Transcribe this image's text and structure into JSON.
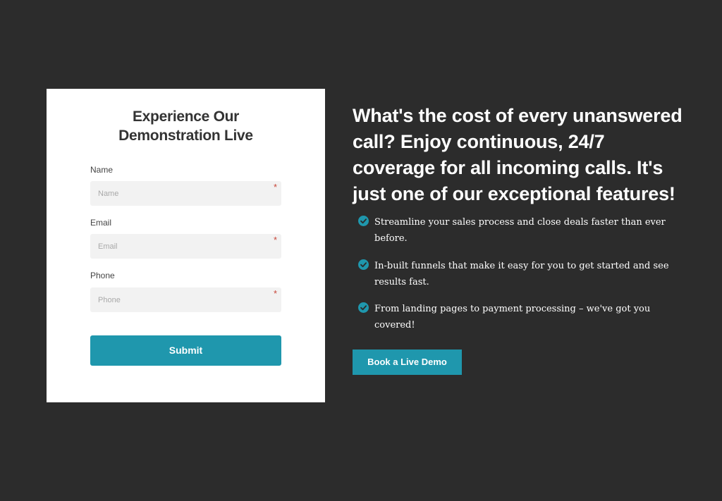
{
  "form": {
    "title_line1": "Experience Our",
    "title_line2": "Demonstration Live",
    "fields": [
      {
        "label": "Name",
        "placeholder": "Name",
        "required_mark": "*"
      },
      {
        "label": "Email",
        "placeholder": "Email",
        "required_mark": "*"
      },
      {
        "label": "Phone",
        "placeholder": "Phone",
        "required_mark": "*"
      }
    ],
    "submit_label": "Submit"
  },
  "promo": {
    "headline": "What's the cost of every unanswered call? Enjoy continuous, 24/7 coverage for all incoming calls. It's just one of our exceptional features!",
    "features": [
      {
        "icon": "check-circle-icon",
        "text": "Streamline your sales process and close deals faster than ever before."
      },
      {
        "icon": "check-circle-icon",
        "text": "In-built funnels that make it easy for you to get started and see results fast."
      },
      {
        "icon": "check-circle-icon",
        "text": "From landing pages to payment processing – we've got you covered!"
      }
    ],
    "cta_label": "Book a Live Demo"
  },
  "colors": {
    "background": "#2c2c2c",
    "card": "#ffffff",
    "accent": "#1f97ad",
    "required": "#c8473a"
  }
}
